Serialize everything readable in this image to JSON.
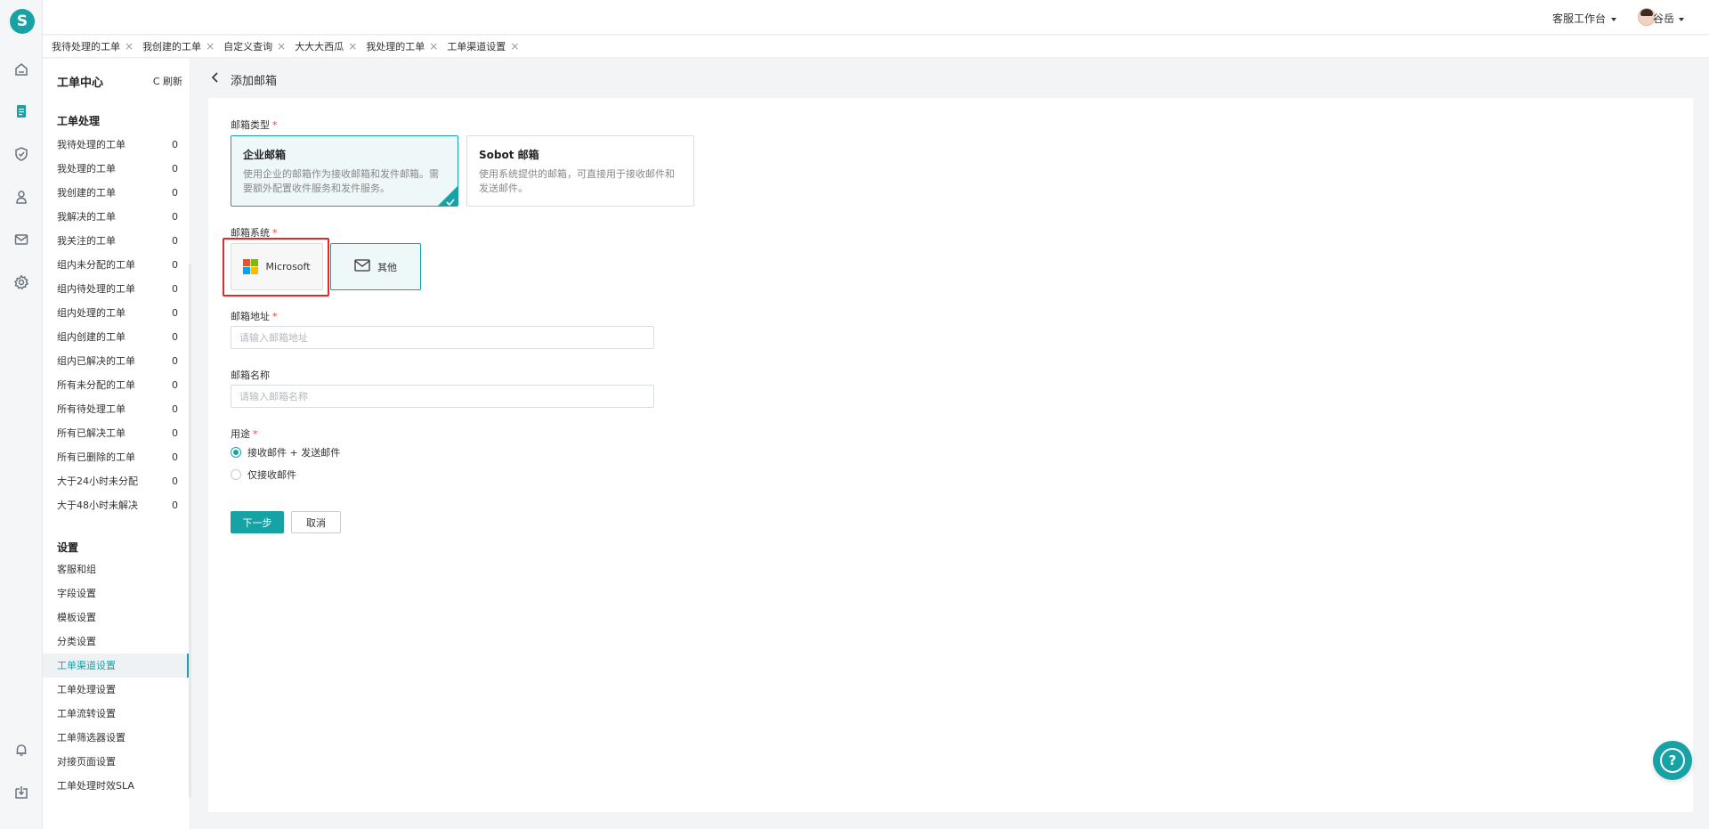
{
  "app": {
    "logo_letter": "S"
  },
  "rail": {
    "icons": [
      "home-icon",
      "ticket-icon",
      "shield-icon",
      "users-icon",
      "mail-icon",
      "gear-icon",
      "bell-icon",
      "download-icon"
    ],
    "active": "ticket-icon"
  },
  "topbar": {
    "workspace": "客服工作台",
    "user": "谷岳"
  },
  "tabs": [
    {
      "label": "我待处理的工单"
    },
    {
      "label": "我创建的工单"
    },
    {
      "label": "自定义查询"
    },
    {
      "label": "大大大西瓜"
    },
    {
      "label": "我处理的工单"
    },
    {
      "label": "工单渠道设置"
    }
  ],
  "sidebar": {
    "title": "工单中心",
    "refresh": "C 刷新",
    "section1": "工单处理",
    "items": [
      {
        "label": "我待处理的工单",
        "count": "0"
      },
      {
        "label": "我处理的工单",
        "count": "0"
      },
      {
        "label": "我创建的工单",
        "count": "0"
      },
      {
        "label": "我解决的工单",
        "count": "0"
      },
      {
        "label": "我关注的工单",
        "count": "0"
      },
      {
        "label": "组内未分配的工单",
        "count": "0"
      },
      {
        "label": "组内待处理的工单",
        "count": "0"
      },
      {
        "label": "组内处理的工单",
        "count": "0"
      },
      {
        "label": "组内创建的工单",
        "count": "0"
      },
      {
        "label": "组内已解决的工单",
        "count": "0"
      },
      {
        "label": "所有未分配的工单",
        "count": "0"
      },
      {
        "label": "所有待处理工单",
        "count": "0"
      },
      {
        "label": "所有已解决工单",
        "count": "0"
      },
      {
        "label": "所有已删除的工单",
        "count": "0"
      },
      {
        "label": "大于24小时未分配",
        "count": "0"
      },
      {
        "label": "大于48小时未解决",
        "count": "0"
      }
    ],
    "section2": "设置",
    "settings": [
      {
        "label": "客服和组"
      },
      {
        "label": "字段设置"
      },
      {
        "label": "模板设置"
      },
      {
        "label": "分类设置"
      },
      {
        "label": "工单渠道设置"
      },
      {
        "label": "工单处理设置"
      },
      {
        "label": "工单流转设置"
      },
      {
        "label": "工单筛选器设置"
      },
      {
        "label": "对接页面设置"
      },
      {
        "label": "工单处理时效SLA"
      }
    ],
    "active_setting": "工单渠道设置"
  },
  "page": {
    "title": "添加邮箱",
    "mail_type_label": "邮箱类型",
    "type_enterprise": {
      "title": "企业邮箱",
      "desc": "使用企业的邮箱作为接收邮箱和发件邮箱。需要额外配置收件服务和发件服务。"
    },
    "type_sobot": {
      "title": "Sobot 邮箱",
      "desc": "使用系统提供的邮箱，可直接用于接收邮件和发送邮件。"
    },
    "mail_system_label": "邮箱系统",
    "sys_microsoft": "Microsoft",
    "sys_other": "其他",
    "address_label": "邮箱地址",
    "address_placeholder": "请输入邮箱地址",
    "name_label": "邮箱名称",
    "name_placeholder": "请输入邮箱名称",
    "usage_label": "用途",
    "usage_options": [
      "接收邮件 + 发送邮件",
      "仅接收邮件"
    ],
    "next_btn": "下一步",
    "cancel_btn": "取消"
  },
  "help": {
    "glyph": "?"
  },
  "colors": {
    "accent": "#17a2a6",
    "highlight": "#e5292b"
  }
}
